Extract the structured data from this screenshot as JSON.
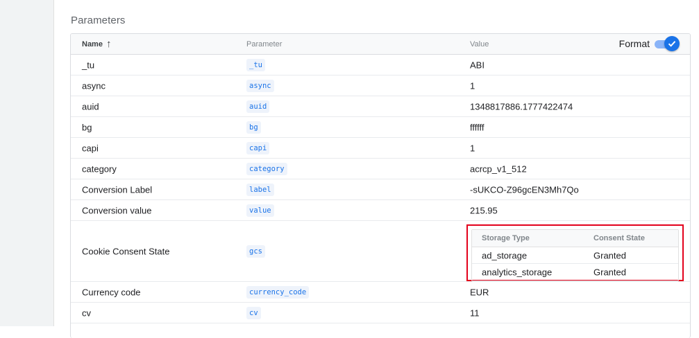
{
  "section": {
    "title": "Parameters"
  },
  "table": {
    "columns": {
      "name": "Name",
      "parameter": "Parameter",
      "value": "Value"
    },
    "sort_icon": "arrow-up-icon",
    "format": {
      "label": "Format",
      "enabled": true
    },
    "rows": [
      {
        "name": "_tu",
        "param": "_tu",
        "value": "ABI"
      },
      {
        "name": "async",
        "param": "async",
        "value": "1"
      },
      {
        "name": "auid",
        "param": "auid",
        "value": "1348817886.1777422474"
      },
      {
        "name": "bg",
        "param": "bg",
        "value": "ffffff"
      },
      {
        "name": "capi",
        "param": "capi",
        "value": "1"
      },
      {
        "name": "category",
        "param": "category",
        "value": "acrcp_v1_512"
      },
      {
        "name": "Conversion Label",
        "param": "label",
        "value": "-sUKCO-Z96gcEN3Mh7Qo"
      },
      {
        "name": "Conversion value",
        "param": "value",
        "value": "215.95"
      },
      {
        "name": "Cookie Consent State",
        "param": "gcs",
        "value": ""
      },
      {
        "name": "Currency code",
        "param": "currency_code",
        "value": "EUR"
      },
      {
        "name": "cv",
        "param": "cv",
        "value": "11"
      }
    ],
    "consent": {
      "headers": {
        "storage_type": "Storage Type",
        "consent_state": "Consent State"
      },
      "rows": [
        {
          "storage": "ad_storage",
          "state": "Granted"
        },
        {
          "storage": "analytics_storage",
          "state": "Granted"
        }
      ],
      "highlight_color": "#e3001b"
    }
  },
  "colors": {
    "accent": "#1a73e8",
    "chip_bg": "#eef3fb"
  }
}
